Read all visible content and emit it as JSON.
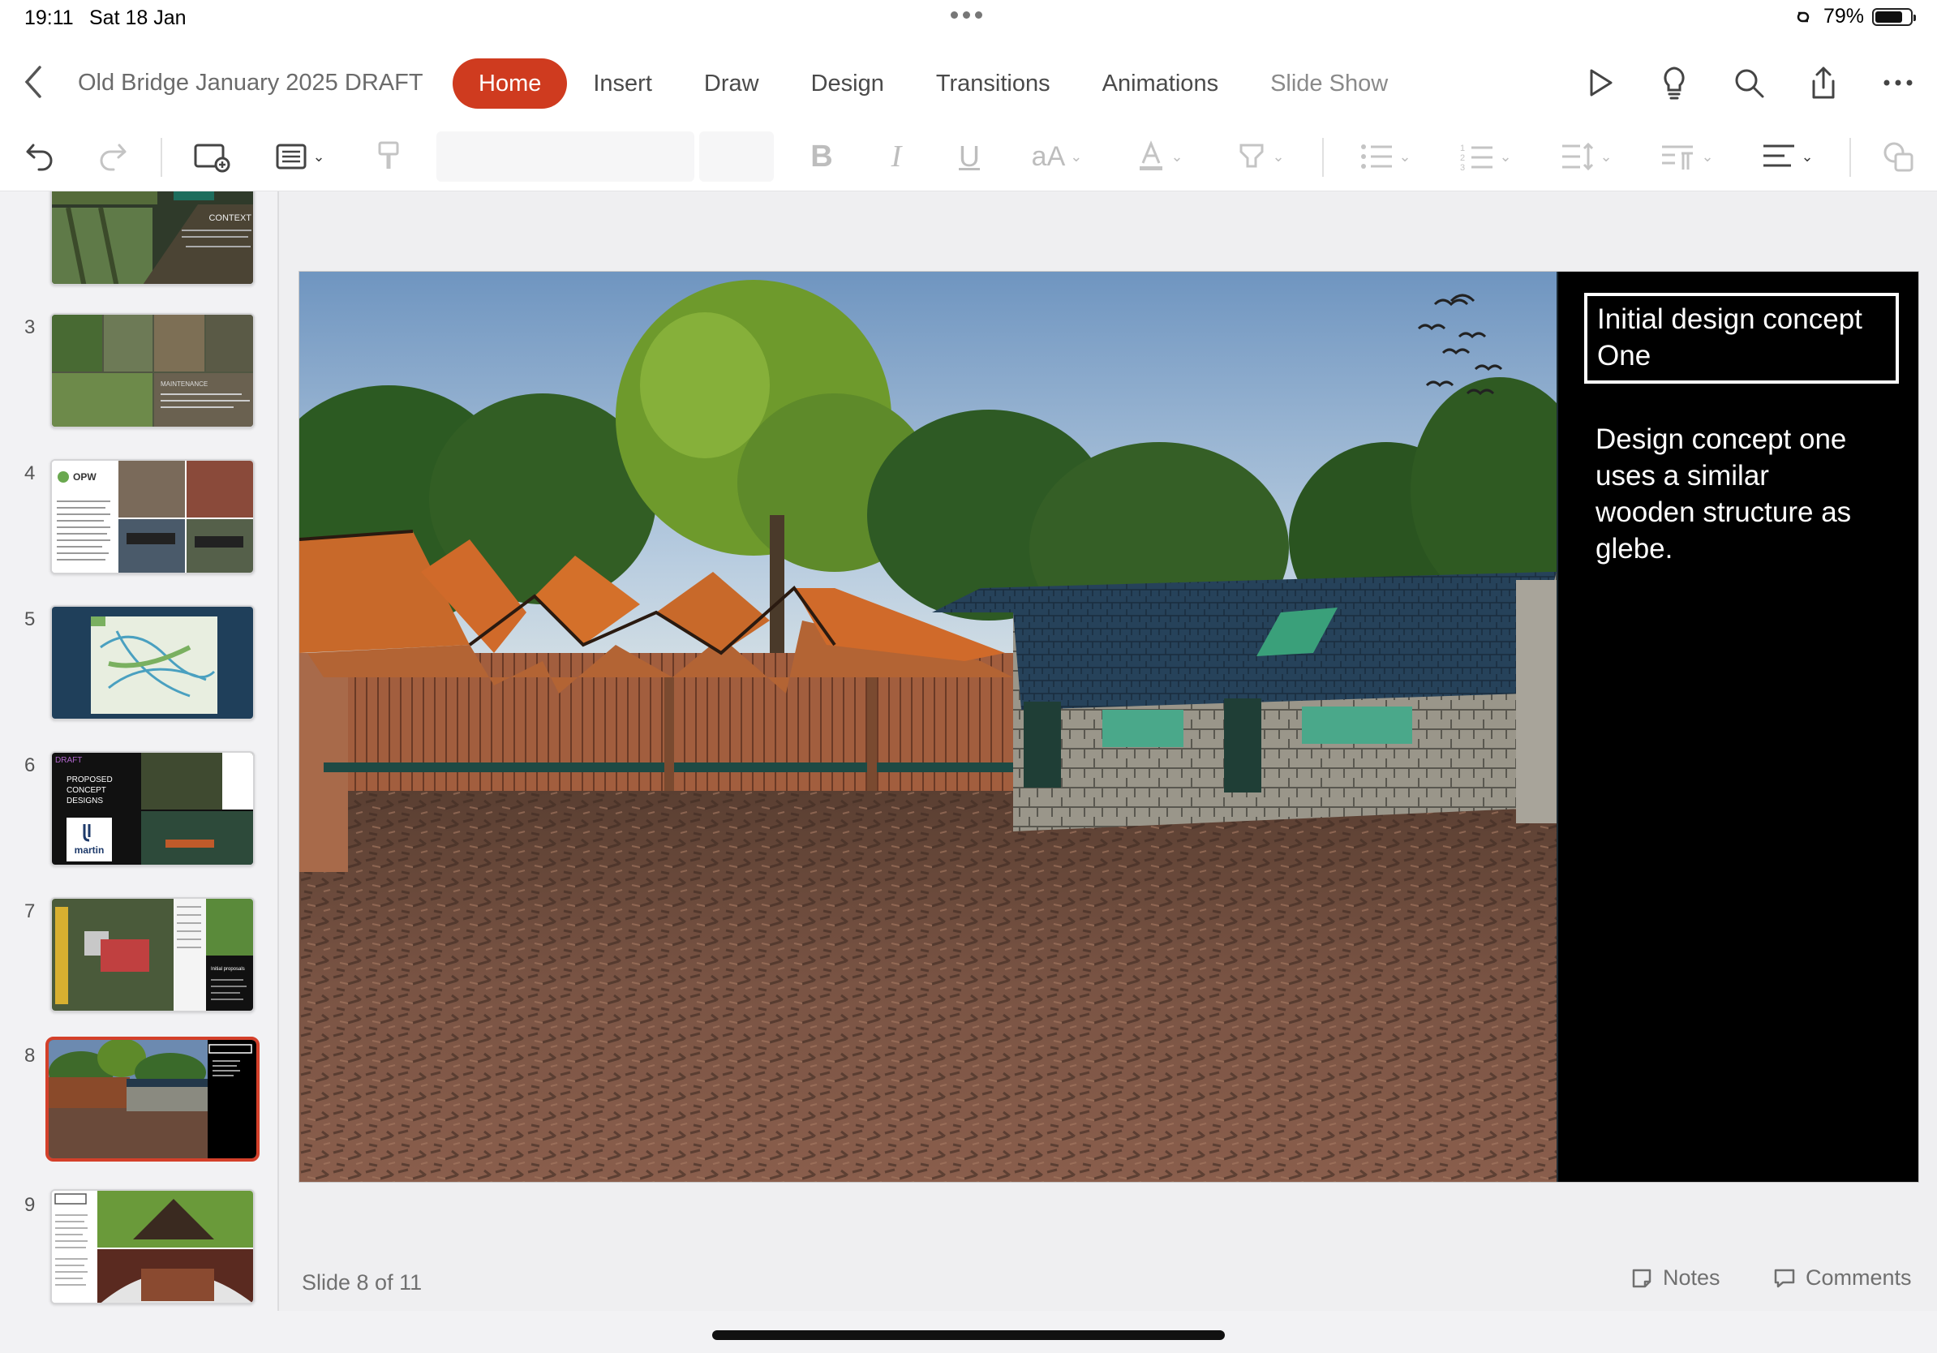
{
  "status_bar": {
    "time": "19:11",
    "date": "Sat 18 Jan",
    "battery_text": "79%",
    "battery_level": 0.79
  },
  "header": {
    "back_icon": "chevron-left-icon",
    "doc_title": "Old Bridge January 2025 DRAFT",
    "tabs": [
      {
        "label": "Home",
        "active": true
      },
      {
        "label": "Insert"
      },
      {
        "label": "Draw"
      },
      {
        "label": "Design"
      },
      {
        "label": "Transitions"
      },
      {
        "label": "Animations"
      },
      {
        "label": "Slide Show"
      }
    ],
    "actions": [
      "play-icon",
      "lightbulb-icon",
      "search-icon",
      "share-icon",
      "more-icon"
    ]
  },
  "toolbar": {
    "buttons": [
      "undo-icon",
      "redo-icon",
      "new-slide-icon",
      "layout-icon",
      "format-painter-icon",
      "bold-icon",
      "italic-icon",
      "underline-icon",
      "font-size-icon",
      "font-color-icon",
      "highlight-icon",
      "bullets-icon",
      "numbering-icon",
      "line-spacing-icon",
      "paragraph-icon",
      "align-icon",
      "shapes-icon"
    ],
    "font_name": "",
    "font_size": ""
  },
  "sidebar": {
    "slides": [
      {
        "number": "",
        "label": "CONTEXT"
      },
      {
        "number": "3",
        "label": "MAINTENANCE"
      },
      {
        "number": "4",
        "label": "OPW"
      },
      {
        "number": "5",
        "label": ""
      },
      {
        "number": "6",
        "label": "PROPOSED CONCEPT DESIGNS",
        "tag": "DRAFT",
        "brand": "martin"
      },
      {
        "number": "7",
        "label": "Initial proposals"
      },
      {
        "number": "8",
        "label": "",
        "selected": true
      },
      {
        "number": "9",
        "label": ""
      }
    ]
  },
  "slide": {
    "title": "Initial design concept One",
    "body": "Design concept one uses a similar wooden structure as glebe."
  },
  "footer": {
    "slide_counter": "Slide 8 of 11",
    "notes_label": "Notes",
    "comments_label": "Comments"
  },
  "colors": {
    "accent": "#cf3b1f",
    "selected_border": "#d4402a"
  }
}
